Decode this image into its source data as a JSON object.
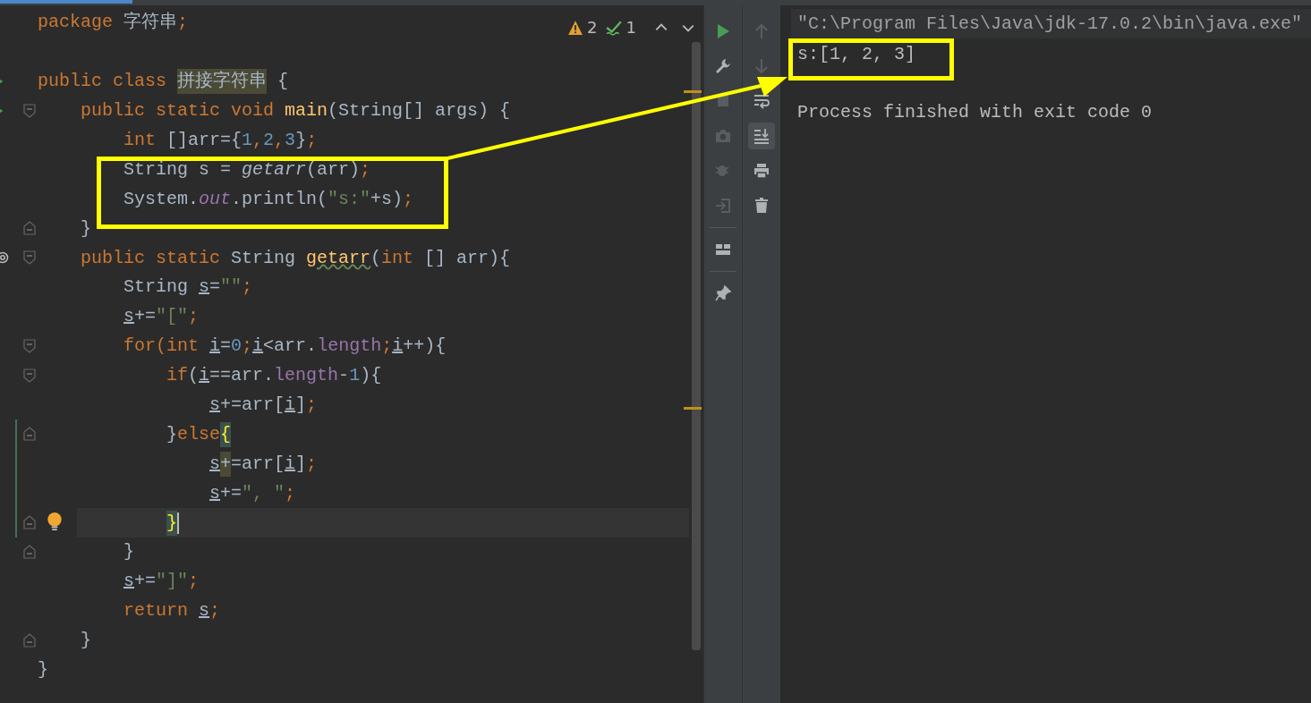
{
  "editor": {
    "inspections": {
      "warnings": "2",
      "weak_warnings": "1"
    },
    "lines": [
      {
        "current": false,
        "changed": false,
        "tokens": [
          {
            "kind": "keyword",
            "text": "package "
          },
          {
            "kind": "plain",
            "text": "字符串"
          },
          {
            "kind": "punct",
            "text": ";"
          }
        ]
      },
      {
        "current": false,
        "changed": false
      },
      {
        "current": false,
        "changed": false,
        "gutter": [
          {
            "kind": "run"
          }
        ],
        "tokens": [
          {
            "kind": "keyword",
            "text": "public class "
          },
          {
            "kind": "hl",
            "text": "拼接字符串"
          },
          {
            "kind": "plain",
            "text": " {"
          }
        ]
      },
      {
        "current": false,
        "changed": false,
        "gutter": [
          {
            "kind": "run"
          },
          {
            "kind": "fold-start"
          }
        ],
        "tokens": [
          {
            "kind": "keyword",
            "text": "    public static void "
          },
          {
            "kind": "method",
            "text": "main"
          },
          {
            "kind": "plain",
            "text": "(String[] args) {"
          }
        ]
      },
      {
        "current": false,
        "changed": false,
        "tokens": [
          {
            "kind": "keyword",
            "text": "        int "
          },
          {
            "kind": "plain",
            "text": "[]arr={"
          },
          {
            "kind": "number",
            "text": "1"
          },
          {
            "kind": "punct",
            "text": ","
          },
          {
            "kind": "number",
            "text": "2"
          },
          {
            "kind": "punct",
            "text": ","
          },
          {
            "kind": "number",
            "text": "3"
          },
          {
            "kind": "plain",
            "text": "}"
          },
          {
            "kind": "punct",
            "text": ";"
          }
        ]
      },
      {
        "current": false,
        "changed": false,
        "tokens": [
          {
            "kind": "plain",
            "text": "        String s = "
          },
          {
            "kind": "call",
            "text": "getarr"
          },
          {
            "kind": "plain",
            "text": "(arr)"
          },
          {
            "kind": "punct",
            "text": ";"
          }
        ]
      },
      {
        "current": false,
        "changed": false,
        "tokens": [
          {
            "kind": "plain",
            "text": "        System."
          },
          {
            "kind": "static",
            "text": "out"
          },
          {
            "kind": "plain",
            "text": ".println("
          },
          {
            "kind": "string",
            "text": "\"s:\""
          },
          {
            "kind": "plain",
            "text": "+s)"
          },
          {
            "kind": "punct",
            "text": ";"
          }
        ]
      },
      {
        "current": false,
        "changed": false,
        "gutter": [
          {
            "kind": "fold-end"
          }
        ],
        "tokens": [
          {
            "kind": "plain",
            "text": "    }"
          }
        ]
      },
      {
        "current": false,
        "changed": false,
        "gutter": [
          {
            "kind": "override"
          },
          {
            "kind": "fold-start"
          }
        ],
        "tokens": [
          {
            "kind": "keyword",
            "text": "    public static "
          },
          {
            "kind": "plain",
            "text": "String "
          },
          {
            "kind": "method-warn",
            "text": "getarr"
          },
          {
            "kind": "plain",
            "text": "("
          },
          {
            "kind": "keyword",
            "text": "int "
          },
          {
            "kind": "plain",
            "text": "[] arr){"
          }
        ]
      },
      {
        "current": false,
        "changed": false,
        "tokens": [
          {
            "kind": "plain",
            "text": "        String "
          },
          {
            "kind": "var",
            "text": "s"
          },
          {
            "kind": "plain",
            "text": "="
          },
          {
            "kind": "string",
            "text": "\"\""
          },
          {
            "kind": "punct",
            "text": ";"
          }
        ]
      },
      {
        "current": false,
        "changed": false,
        "tokens": [
          {
            "kind": "var",
            "text": "        s"
          },
          {
            "kind": "plain",
            "text": "+="
          },
          {
            "kind": "string",
            "text": "\"[\""
          },
          {
            "kind": "punct",
            "text": ";"
          }
        ]
      },
      {
        "current": false,
        "changed": false,
        "gutter": [
          {
            "kind": "fold-start"
          }
        ],
        "tokens": [
          {
            "kind": "keyword",
            "text": "        for(int "
          },
          {
            "kind": "var",
            "text": "i"
          },
          {
            "kind": "plain",
            "text": "="
          },
          {
            "kind": "number",
            "text": "0"
          },
          {
            "kind": "punct",
            "text": ";"
          },
          {
            "kind": "var",
            "text": "i"
          },
          {
            "kind": "plain",
            "text": "<arr."
          },
          {
            "kind": "field",
            "text": "length"
          },
          {
            "kind": "punct",
            "text": ";"
          },
          {
            "kind": "var",
            "text": "i"
          },
          {
            "kind": "plain",
            "text": "++){"
          }
        ]
      },
      {
        "current": false,
        "changed": false,
        "gutter": [
          {
            "kind": "fold-start"
          }
        ],
        "tokens": [
          {
            "kind": "keyword",
            "text": "            if"
          },
          {
            "kind": "plain",
            "text": "("
          },
          {
            "kind": "var",
            "text": "i"
          },
          {
            "kind": "plain",
            "text": "==arr."
          },
          {
            "kind": "field",
            "text": "length"
          },
          {
            "kind": "plain",
            "text": "-"
          },
          {
            "kind": "number",
            "text": "1"
          },
          {
            "kind": "plain",
            "text": "){"
          }
        ]
      },
      {
        "current": false,
        "changed": false,
        "tokens": [
          {
            "kind": "var",
            "text": "                s"
          },
          {
            "kind": "plain",
            "text": "+=arr["
          },
          {
            "kind": "var",
            "text": "i"
          },
          {
            "kind": "plain",
            "text": "]"
          },
          {
            "kind": "punct",
            "text": ";"
          }
        ]
      },
      {
        "current": false,
        "changed": true,
        "gutter": [
          {
            "kind": "fold-end"
          }
        ],
        "tokens": [
          {
            "kind": "plain",
            "text": "            }"
          },
          {
            "kind": "keyword",
            "text": "else"
          },
          {
            "kind": "brace",
            "text": "{"
          }
        ]
      },
      {
        "current": false,
        "changed": true,
        "tokens": [
          {
            "kind": "var",
            "text": "                s"
          },
          {
            "kind": "hl",
            "text": "+"
          },
          {
            "kind": "plain",
            "text": "=arr["
          },
          {
            "kind": "var",
            "text": "i"
          },
          {
            "kind": "plain",
            "text": "]"
          },
          {
            "kind": "punct",
            "text": ";"
          }
        ]
      },
      {
        "current": false,
        "changed": true,
        "tokens": [
          {
            "kind": "var",
            "text": "                s"
          },
          {
            "kind": "plain",
            "text": "+="
          },
          {
            "kind": "string",
            "text": "\", \""
          },
          {
            "kind": "punct",
            "text": ";"
          }
        ]
      },
      {
        "current": true,
        "changed": true,
        "gutter": [
          {
            "kind": "bulb"
          },
          {
            "kind": "fold-end"
          }
        ],
        "tokens": [
          {
            "kind": "brace",
            "text": "            }"
          }
        ]
      },
      {
        "current": false,
        "changed": false,
        "gutter": [
          {
            "kind": "fold-end"
          }
        ],
        "tokens": [
          {
            "kind": "plain",
            "text": "        }"
          }
        ]
      },
      {
        "current": false,
        "changed": false,
        "tokens": [
          {
            "kind": "var",
            "text": "        s"
          },
          {
            "kind": "plain",
            "text": "+="
          },
          {
            "kind": "string",
            "text": "\"]\""
          },
          {
            "kind": "punct",
            "text": ";"
          }
        ]
      },
      {
        "current": false,
        "changed": false,
        "tokens": [
          {
            "kind": "keyword",
            "text": "        return "
          },
          {
            "kind": "var",
            "text": "s"
          },
          {
            "kind": "punct",
            "text": ";"
          }
        ]
      },
      {
        "current": false,
        "changed": false,
        "gutter": [
          {
            "kind": "fold-end"
          }
        ],
        "tokens": [
          {
            "kind": "plain",
            "text": "    }"
          }
        ]
      },
      {
        "current": false,
        "changed": false,
        "tokens": [
          {
            "kind": "plain",
            "text": "}"
          }
        ]
      }
    ]
  },
  "run_toolbar": [
    {
      "disabled": false
    },
    {
      "disabled": false
    },
    {
      "disabled": true
    },
    {
      "disabled": true
    },
    {
      "disabled": true
    },
    {
      "disabled": true
    },
    {
      "disabled": false
    },
    {
      "disabled": false
    }
  ],
  "console_toolbar": [
    {
      "disabled": true,
      "selected": false
    },
    {
      "disabled": true,
      "selected": false
    },
    {
      "disabled": false,
      "selected": false
    },
    {
      "disabled": false,
      "selected": true
    },
    {
      "disabled": false,
      "selected": false
    },
    {
      "disabled": false,
      "selected": false
    }
  ],
  "console": [
    {
      "kind": "command",
      "text": "\"C:\\Program Files\\Java\\jdk-17.0.2\\bin\\java.exe\""
    },
    {
      "kind": "output",
      "text": "s:[1, 2, 3]"
    },
    {
      "kind": "system",
      "text": "Process finished with exit code 0"
    }
  ]
}
